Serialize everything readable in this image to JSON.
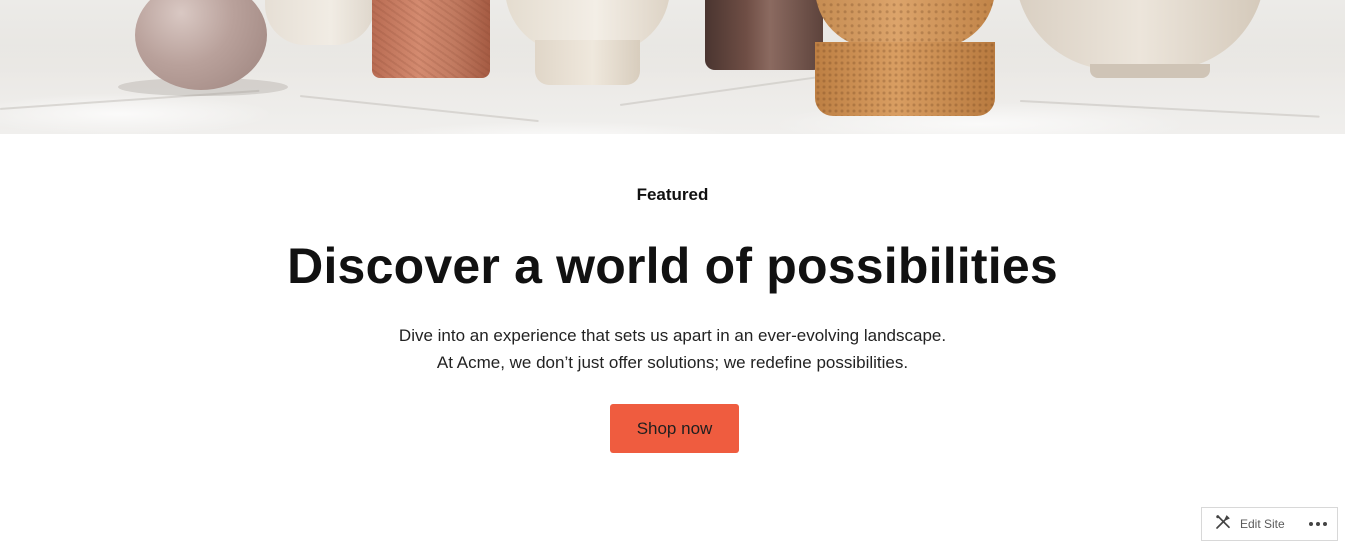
{
  "hero": {
    "image_description_icon": "ceramic-vases-photo"
  },
  "section": {
    "eyebrow": "Featured",
    "headline": "Discover a world of possibilities",
    "description_line1": "Dive into an experience that sets us apart in an ever-evolving landscape.",
    "description_line2": "At Acme, we don’t just offer solutions; we redefine possibilities.",
    "cta_label": "Shop now"
  },
  "admin_toolbar": {
    "edit_icon": "tools-icon",
    "edit_label": "Edit Site",
    "more_icon": "ellipsis-icon"
  },
  "colors": {
    "accent": "#ef5c3f",
    "text": "#111111",
    "background": "#ffffff"
  }
}
